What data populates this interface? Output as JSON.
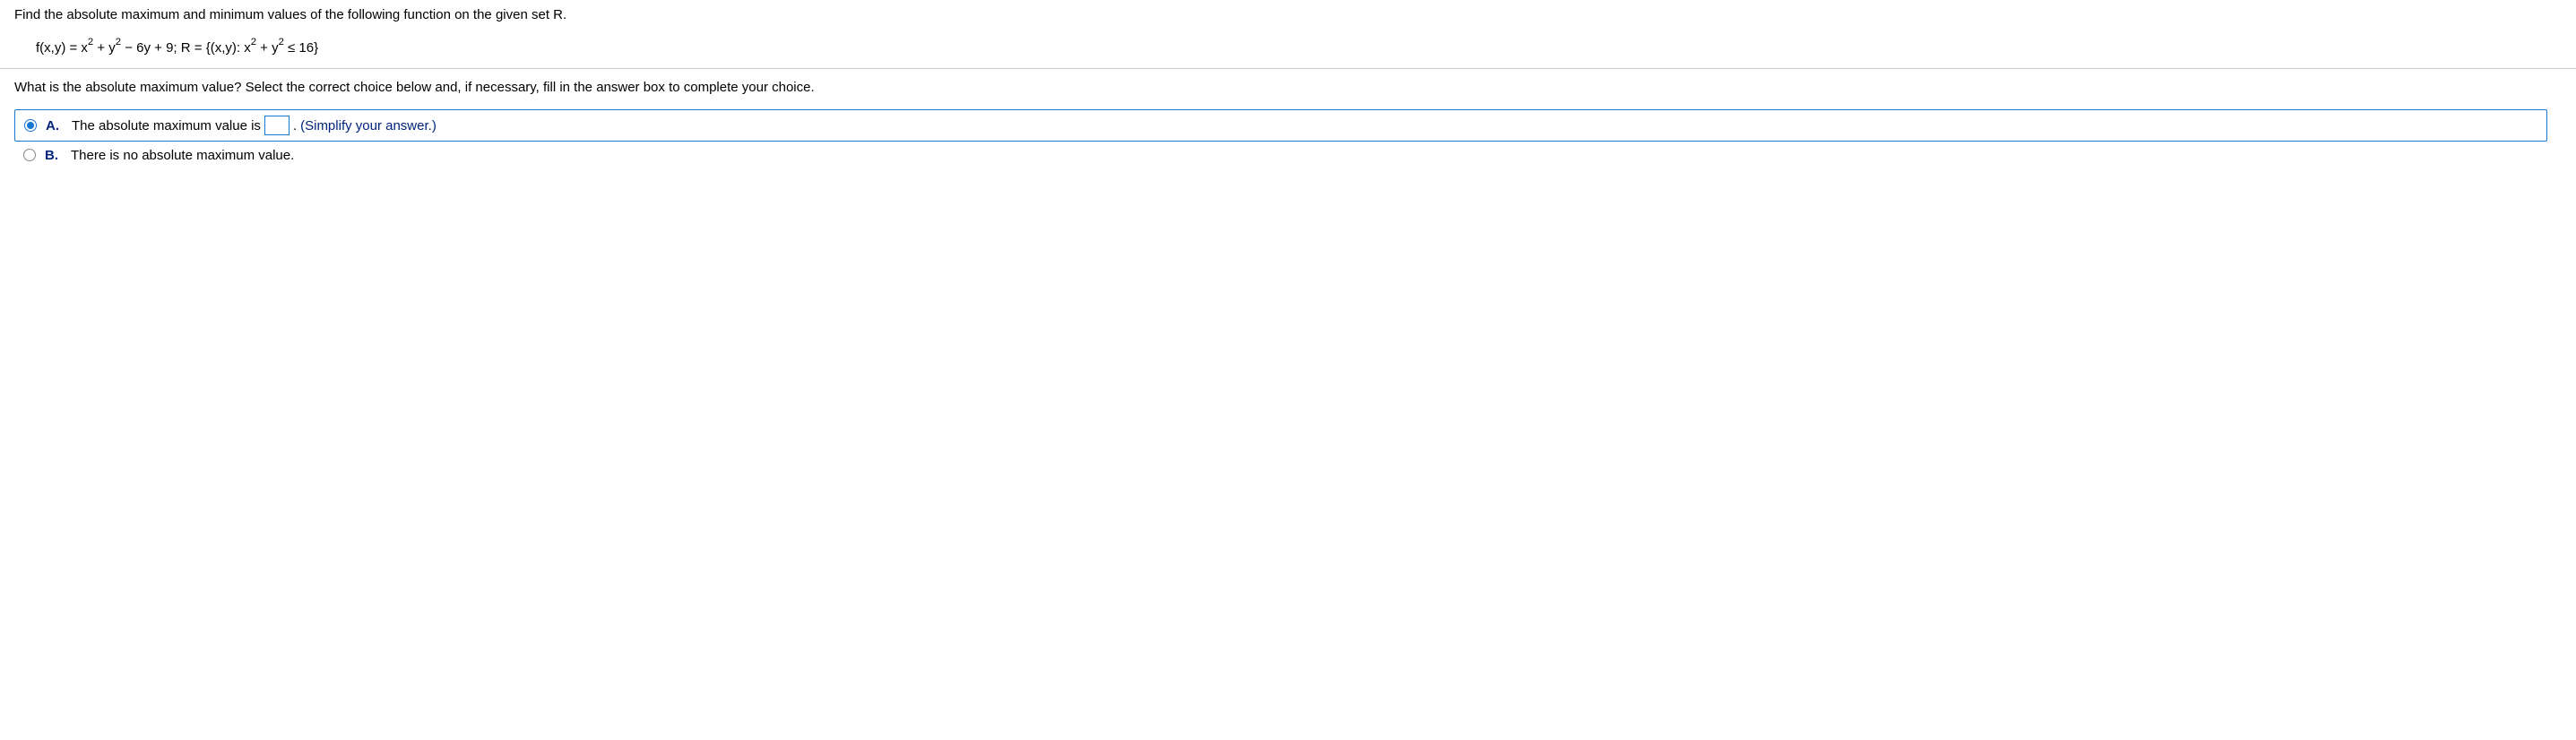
{
  "problem": {
    "instruction": "Find the absolute maximum and minimum values of the following function on the given set R.",
    "formula": {
      "prefix": "f(x,y) = x",
      "exp1": "2",
      "mid1": " + y",
      "exp2": "2",
      "mid2": " − 6y + 9; R = {(x,y): x",
      "exp3": "2",
      "mid3": " + y",
      "exp4": "2",
      "suffix": " ≤ 16}"
    }
  },
  "question": "What is the absolute maximum value? Select the correct choice below and, if necessary, fill in the answer box to complete your choice.",
  "choices": {
    "a": {
      "letter": "A.",
      "text_before": "The absolute maximum value is",
      "text_after": ".",
      "hint": "(Simplify your answer.)"
    },
    "b": {
      "letter": "B.",
      "text": "There is no absolute maximum value."
    }
  }
}
